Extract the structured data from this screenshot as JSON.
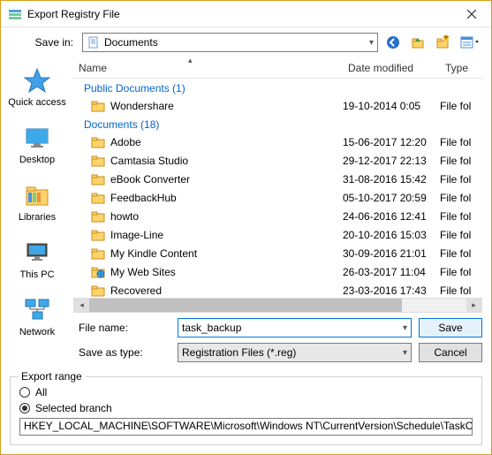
{
  "window": {
    "title": "Export Registry File"
  },
  "toolbar": {
    "save_in_label": "Save in:",
    "location": "Documents"
  },
  "places": [
    {
      "id": "quick-access",
      "label": "Quick access"
    },
    {
      "id": "desktop",
      "label": "Desktop"
    },
    {
      "id": "libraries",
      "label": "Libraries"
    },
    {
      "id": "this-pc",
      "label": "This PC"
    },
    {
      "id": "network",
      "label": "Network"
    }
  ],
  "columns": {
    "name": "Name",
    "date": "Date modified",
    "type": "Type"
  },
  "groups": [
    {
      "label": "Public Documents (1)",
      "items": [
        {
          "name": "Wondershare",
          "date": "19-10-2014 0:05",
          "type": "File fol",
          "icon": "folder"
        }
      ]
    },
    {
      "label": "Documents (18)",
      "items": [
        {
          "name": "Adobe",
          "date": "15-06-2017 12:20",
          "type": "File fol",
          "icon": "folder"
        },
        {
          "name": "Camtasia Studio",
          "date": "29-12-2017 22:13",
          "type": "File fol",
          "icon": "folder"
        },
        {
          "name": "eBook Converter",
          "date": "31-08-2016 15:42",
          "type": "File fol",
          "icon": "folder"
        },
        {
          "name": "FeedbackHub",
          "date": "05-10-2017 20:59",
          "type": "File fol",
          "icon": "folder"
        },
        {
          "name": "howto",
          "date": "24-06-2016 12:41",
          "type": "File fol",
          "icon": "folder"
        },
        {
          "name": "Image-Line",
          "date": "20-10-2016 15:03",
          "type": "File fol",
          "icon": "folder"
        },
        {
          "name": "My Kindle Content",
          "date": "30-09-2016 21:01",
          "type": "File fol",
          "icon": "folder"
        },
        {
          "name": "My Web Sites",
          "date": "26-03-2017 11:04",
          "type": "File fol",
          "icon": "web-folder"
        },
        {
          "name": "Recovered",
          "date": "23-03-2016 17:43",
          "type": "File fol",
          "icon": "folder"
        }
      ]
    }
  ],
  "file": {
    "name_label": "File name:",
    "name_value": "task_backup",
    "type_label": "Save as type:",
    "type_value": "Registration Files (*.reg)"
  },
  "buttons": {
    "save": "Save",
    "cancel": "Cancel"
  },
  "export_range": {
    "legend": "Export range",
    "all": "All",
    "selected": "Selected branch",
    "selected_checked": true,
    "branch": "HKEY_LOCAL_MACHINE\\SOFTWARE\\Microsoft\\Windows NT\\CurrentVersion\\Schedule\\TaskCache"
  }
}
